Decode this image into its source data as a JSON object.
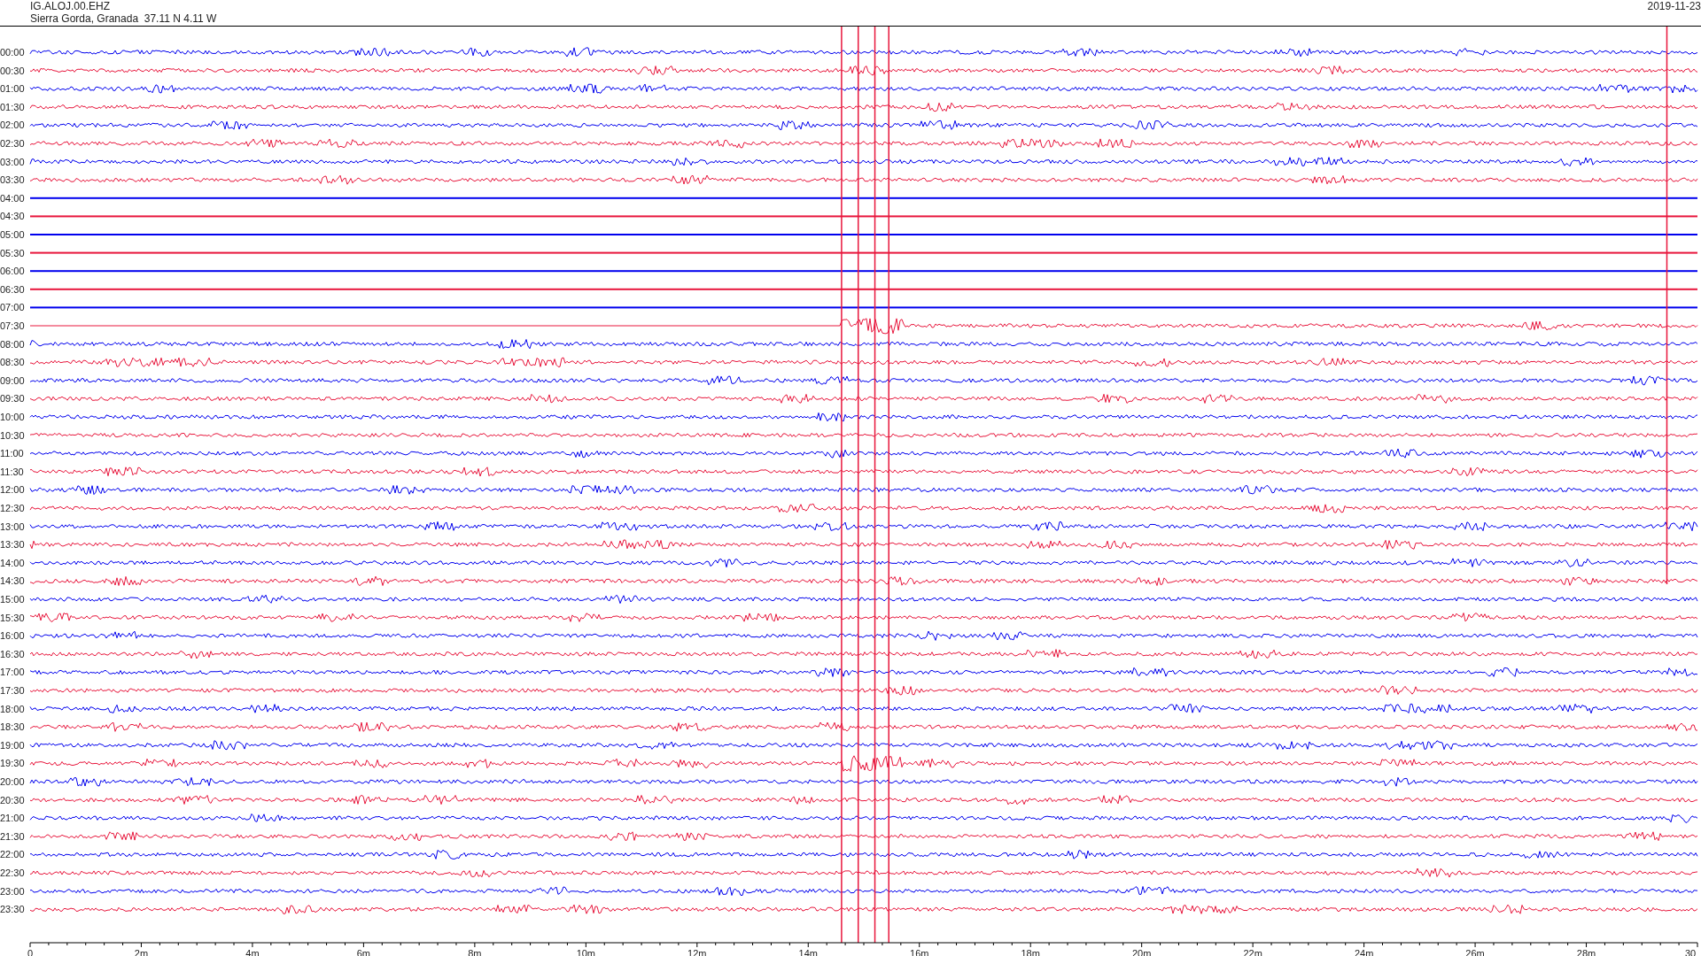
{
  "header": {
    "station": "IG.ALOJ.00.EHZ",
    "location": "Sierra Gorda, Granada  37.11 N 4.11 W",
    "date": "2019-11-23"
  },
  "traces": [
    {
      "label": "00:00",
      "color": "#0000ee",
      "kind": "noisy"
    },
    {
      "label": "00:30",
      "color": "#e8163c",
      "kind": "noisy"
    },
    {
      "label": "01:00",
      "color": "#0000ee",
      "kind": "noisy"
    },
    {
      "label": "01:30",
      "color": "#e8163c",
      "kind": "noisy"
    },
    {
      "label": "02:00",
      "color": "#0000ee",
      "kind": "noisy"
    },
    {
      "label": "02:30",
      "color": "#e8163c",
      "kind": "noisy"
    },
    {
      "label": "03:00",
      "color": "#0000ee",
      "kind": "noisy"
    },
    {
      "label": "03:30",
      "color": "#e8163c",
      "kind": "noisy"
    },
    {
      "label": "04:00",
      "color": "#0000ee",
      "kind": "flat"
    },
    {
      "label": "04:30",
      "color": "#e8163c",
      "kind": "flat"
    },
    {
      "label": "05:00",
      "color": "#0000ee",
      "kind": "flat"
    },
    {
      "label": "05:30",
      "color": "#e8163c",
      "kind": "flat"
    },
    {
      "label": "06:00",
      "color": "#0000ee",
      "kind": "flat"
    },
    {
      "label": "06:30",
      "color": "#e8163c",
      "kind": "flat"
    },
    {
      "label": "07:00",
      "color": "#0000ee",
      "kind": "flat"
    },
    {
      "label": "07:30",
      "color": "#e8163c",
      "kind": "partial"
    },
    {
      "label": "08:00",
      "color": "#0000ee",
      "kind": "noisy"
    },
    {
      "label": "08:30",
      "color": "#e8163c",
      "kind": "noisy"
    },
    {
      "label": "09:00",
      "color": "#0000ee",
      "kind": "noisy"
    },
    {
      "label": "09:30",
      "color": "#e8163c",
      "kind": "noisy"
    },
    {
      "label": "10:00",
      "color": "#0000ee",
      "kind": "noisy"
    },
    {
      "label": "10:30",
      "color": "#e8163c",
      "kind": "noisy"
    },
    {
      "label": "11:00",
      "color": "#0000ee",
      "kind": "noisy"
    },
    {
      "label": "11:30",
      "color": "#e8163c",
      "kind": "noisy"
    },
    {
      "label": "12:00",
      "color": "#0000ee",
      "kind": "noisy"
    },
    {
      "label": "12:30",
      "color": "#e8163c",
      "kind": "noisy"
    },
    {
      "label": "13:00",
      "color": "#0000ee",
      "kind": "noisy"
    },
    {
      "label": "13:30",
      "color": "#e8163c",
      "kind": "noisy"
    },
    {
      "label": "14:00",
      "color": "#0000ee",
      "kind": "noisy"
    },
    {
      "label": "14:30",
      "color": "#e8163c",
      "kind": "noisy"
    },
    {
      "label": "15:00",
      "color": "#0000ee",
      "kind": "noisy"
    },
    {
      "label": "15:30",
      "color": "#e8163c",
      "kind": "noisy"
    },
    {
      "label": "16:00",
      "color": "#0000ee",
      "kind": "noisy"
    },
    {
      "label": "16:30",
      "color": "#e8163c",
      "kind": "noisy"
    },
    {
      "label": "17:00",
      "color": "#0000ee",
      "kind": "noisy"
    },
    {
      "label": "17:30",
      "color": "#e8163c",
      "kind": "noisy"
    },
    {
      "label": "18:00",
      "color": "#0000ee",
      "kind": "noisy"
    },
    {
      "label": "18:30",
      "color": "#e8163c",
      "kind": "noisy"
    },
    {
      "label": "19:00",
      "color": "#0000ee",
      "kind": "noisy"
    },
    {
      "label": "19:30",
      "color": "#e8163c",
      "kind": "burst"
    },
    {
      "label": "20:00",
      "color": "#0000ee",
      "kind": "noisy"
    },
    {
      "label": "20:30",
      "color": "#e8163c",
      "kind": "noisy"
    },
    {
      "label": "21:00",
      "color": "#0000ee",
      "kind": "noisy"
    },
    {
      "label": "21:30",
      "color": "#e8163c",
      "kind": "noisy"
    },
    {
      "label": "22:00",
      "color": "#0000ee",
      "kind": "noisy"
    },
    {
      "label": "22:30",
      "color": "#e8163c",
      "kind": "noisy"
    },
    {
      "label": "23:00",
      "color": "#0000ee",
      "kind": "noisy"
    },
    {
      "label": "23:30",
      "color": "#e8163c",
      "kind": "noisy"
    }
  ],
  "axis": {
    "ticks": [
      "0",
      "2m",
      "4m",
      "6m",
      "8m",
      "10m",
      "12m",
      "14m",
      "16m",
      "18m",
      "20m",
      "22m",
      "24m",
      "26m",
      "28m",
      "30"
    ]
  }
}
